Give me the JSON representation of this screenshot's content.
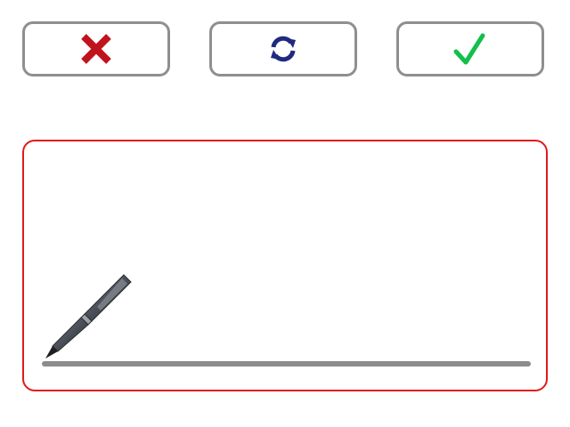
{
  "toolbar": {
    "cancel": {
      "icon": "close-icon",
      "color": "#c0141c"
    },
    "clear": {
      "icon": "refresh-icon",
      "color": "#1f2a80"
    },
    "accept": {
      "icon": "checkmark-icon",
      "color": "#13bf4d"
    }
  },
  "signature_pad": {
    "border_color": "#e11b1b",
    "line_color": "#8c8c8c",
    "pen_icon": "pen-icon",
    "is_empty": true
  }
}
